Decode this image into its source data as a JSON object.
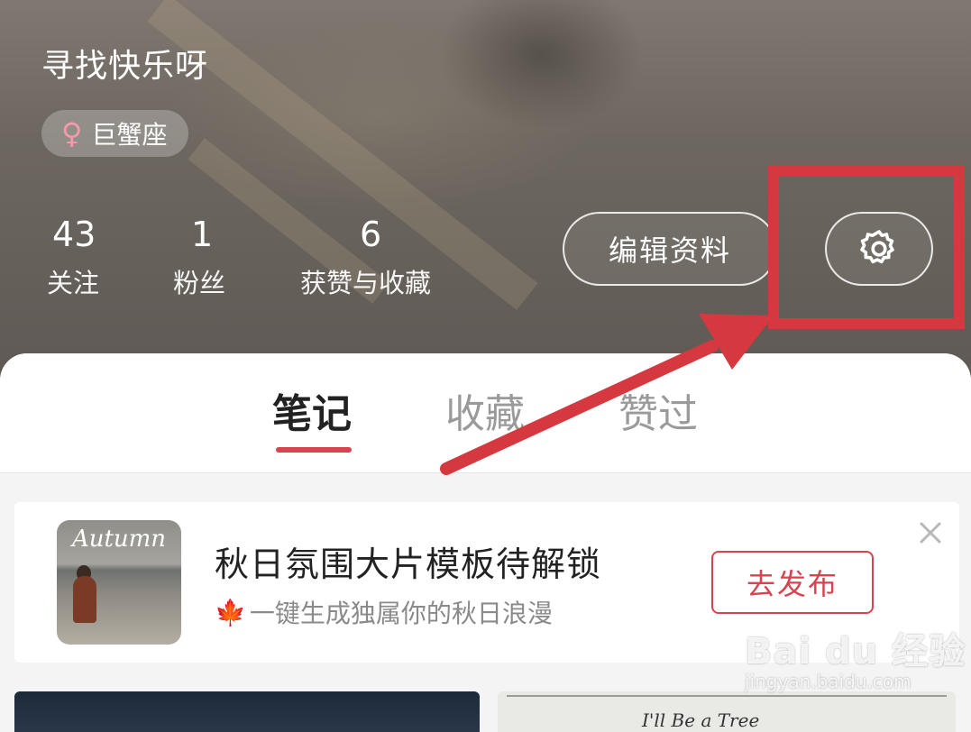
{
  "profile": {
    "username": "寻找快乐呀",
    "zodiac": {
      "icon": "female-icon",
      "glyph": "♀",
      "label": "巨蟹座"
    },
    "stats": [
      {
        "value": "43",
        "label": "关注"
      },
      {
        "value": "1",
        "label": "粉丝"
      },
      {
        "value": "6",
        "label": "获赞与收藏"
      }
    ],
    "edit_button_label": "编辑资料",
    "settings_icon": "gear-icon"
  },
  "tabs": [
    {
      "label": "笔记",
      "active": true
    },
    {
      "label": "收藏",
      "active": false
    },
    {
      "label": "赞过",
      "active": false
    }
  ],
  "promo": {
    "thumbnail_title": "Autumn",
    "title": "秋日氛围大片模板待解锁",
    "subtitle_icon": "maple-leaf-icon",
    "subtitle_glyph": "🍁",
    "subtitle": "一键生成独属你的秋日浪漫",
    "action_label": "去发布",
    "close_icon": "close-icon"
  },
  "feed": {
    "card_b_text": "I'll Be a Tree"
  },
  "watermark": {
    "main": "Bai du 经验",
    "sub": "jingyan.baidu.com"
  },
  "colors": {
    "accent": "#d8434f",
    "annotation": "#d6383f",
    "zodiac_icon": "#f49aa8"
  }
}
